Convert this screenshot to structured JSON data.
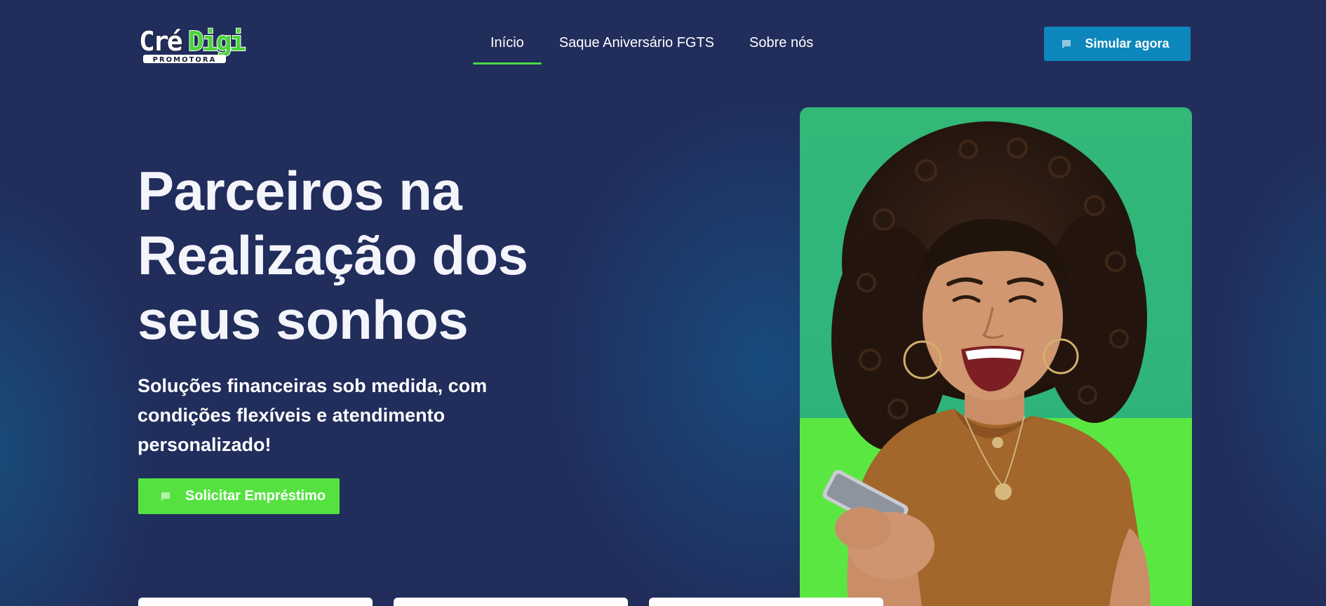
{
  "brand": {
    "logo_primary": "Cré",
    "logo_accent": "Digi",
    "logo_tagline": "PROMOTORA",
    "colors": {
      "background": "#212d5b",
      "accent_green": "#55e241",
      "accent_blue": "#0d86bc"
    }
  },
  "nav": {
    "items": [
      {
        "label": "Início",
        "active": true
      },
      {
        "label": "Saque Aniversário FGTS",
        "active": false
      },
      {
        "label": "Sobre nós",
        "active": false
      }
    ],
    "cta_label": "Simular agora",
    "cta_icon": "chat-icon"
  },
  "hero": {
    "title_lines": [
      "Parceiros na",
      "Realização dos",
      "seus sonhos"
    ],
    "subtitle_lines": [
      "Soluções financeiras sob medida, com",
      "condições flexíveis e atendimento",
      "personalizado!"
    ],
    "cta_label": "Solicitar Empréstimo",
    "cta_icon": "chat-icon",
    "image": "woman-smiling-with-phone"
  },
  "features": {
    "cards_visible": 3
  }
}
